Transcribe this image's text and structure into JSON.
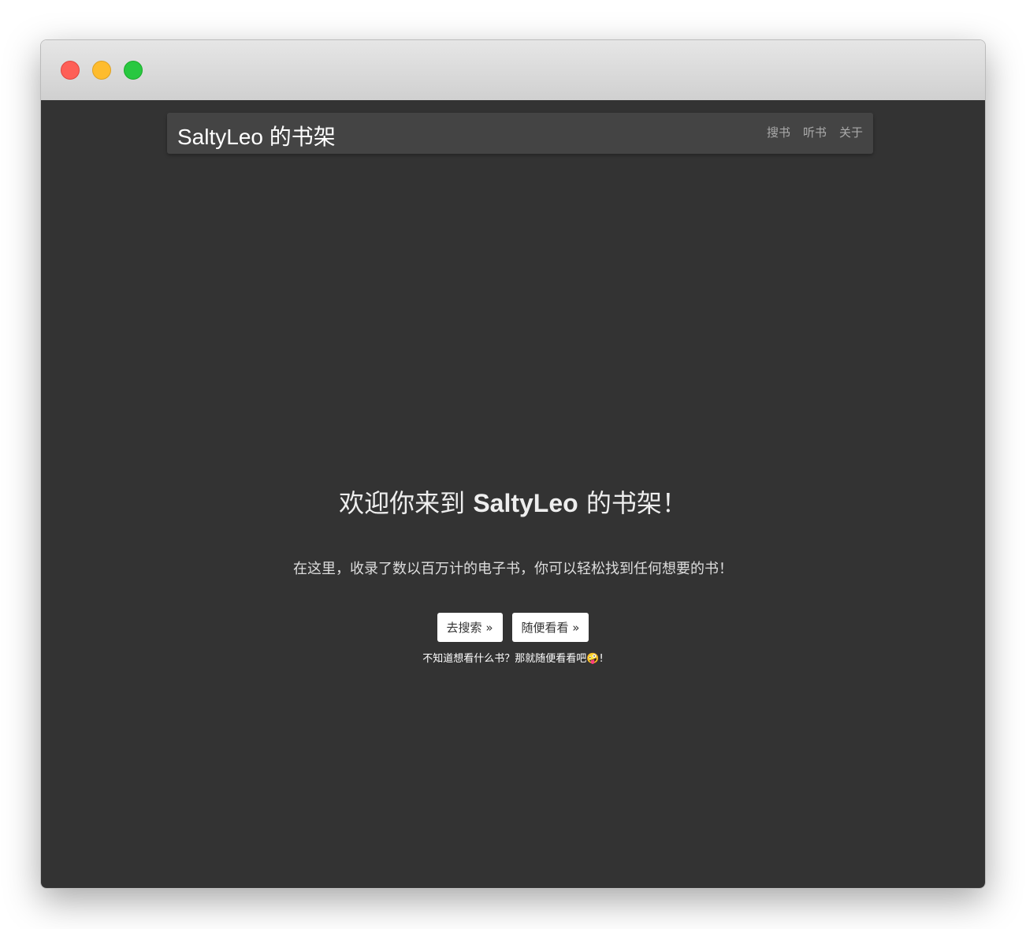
{
  "navbar": {
    "brand": "SaltyLeo 的书架",
    "links": [
      "搜书",
      "听书",
      "关于"
    ]
  },
  "hero": {
    "title_prefix": "欢迎你来到 ",
    "title_brand": "SaltyLeo",
    "title_suffix": " 的书架！",
    "subtitle": "在这里，收录了数以百万计的电子书，你可以轻松找到任何想要的书！",
    "search_button": "去搜索",
    "random_button": "随便看看",
    "raquo": "»",
    "hint": "不知道想看什么书？那就随便看看吧",
    "hint_emoji": "🤪",
    "hint_end": "!"
  }
}
